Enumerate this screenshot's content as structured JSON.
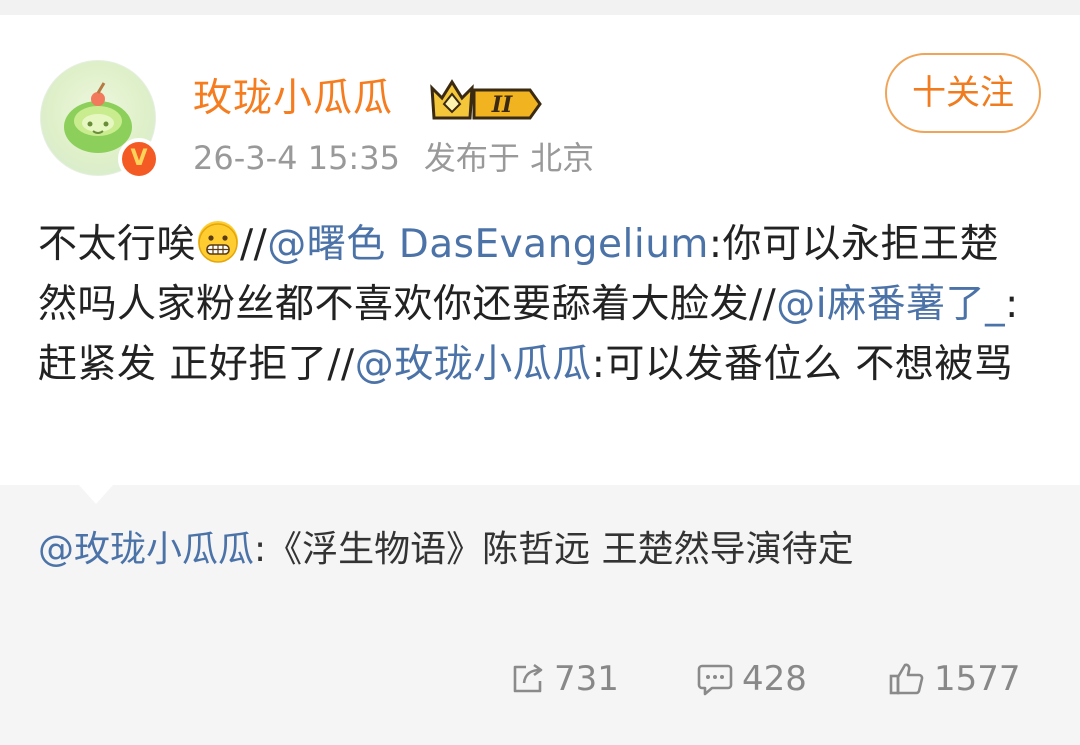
{
  "post": {
    "username": "玫珑小瓜瓜",
    "level_badge": "II",
    "timestamp": "26-3-4 15:35",
    "location": "发布于 北京",
    "follow_label": "十关注",
    "content": {
      "t1": "不太行唉",
      "sep1": "//",
      "m1": "@曙色 DasEvangelium",
      "t2": ":你可以永拒王楚然吗人家粉丝都不喜欢你还要舔着大脸发//",
      "m2": "@i麻番薯了_",
      "t3": ":赶紧发 正好拒了//",
      "m3": "@玫珑小瓜瓜",
      "t4": ":可以发番位么 不想被骂"
    }
  },
  "original": {
    "mention": "@玫珑小瓜瓜",
    "text": ":《浮生物语》陈哲远 王楚然导演待定"
  },
  "stats": {
    "reposts": "731",
    "comments": "428",
    "likes": "1577"
  },
  "icons": {
    "verified": "verified-v-icon",
    "crown": "crown-level-icon",
    "emoji": "grimace-emoji",
    "repost": "repost-icon",
    "comment": "comment-icon",
    "like": "thumbs-up-icon"
  },
  "colors": {
    "username": "#f57c1f",
    "mention": "#4c73a8",
    "follow_border": "#f0a458"
  }
}
